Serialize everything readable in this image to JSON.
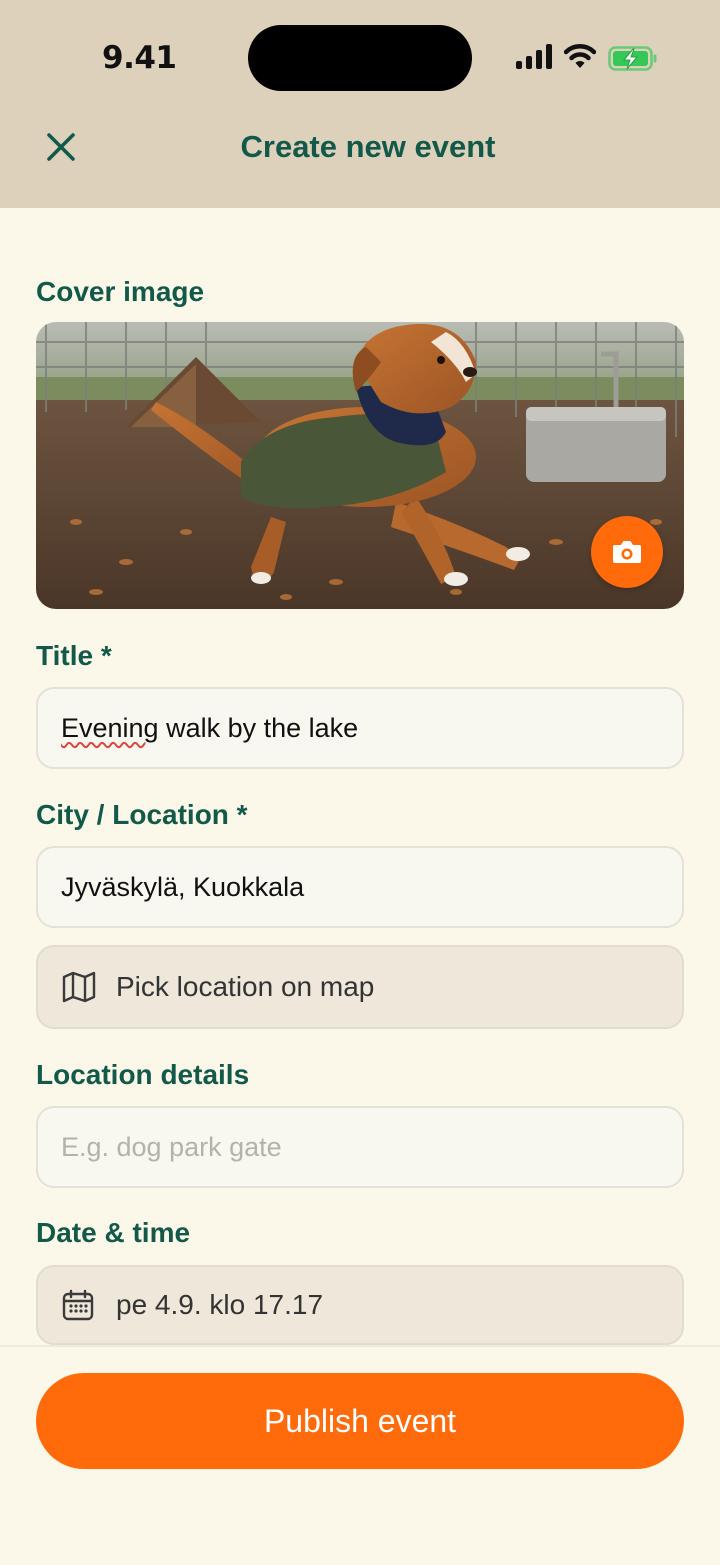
{
  "status_bar": {
    "time": "9.41"
  },
  "header": {
    "title": "Create new event",
    "close_icon": "close-icon"
  },
  "form": {
    "cover_label": "Cover image",
    "title_label": "Title *",
    "title_value_word1": "Evening",
    "title_value_rest": " walk by the lake",
    "location_label": "City / Location *",
    "location_value": "Jyväskylä, Kuokkala",
    "pick_location_label": "Pick location on map",
    "details_label": "Location details",
    "details_placeholder": "E.g. dog park gate",
    "datetime_label": "Date & time",
    "datetime_value": "pe 4.9. klo 17.17"
  },
  "actions": {
    "publish_label": "Publish event"
  },
  "colors": {
    "accent": "#ff6a0b",
    "heading": "#12594a",
    "header_bg": "#ddd1bc",
    "page_bg": "#fbf8ea"
  }
}
